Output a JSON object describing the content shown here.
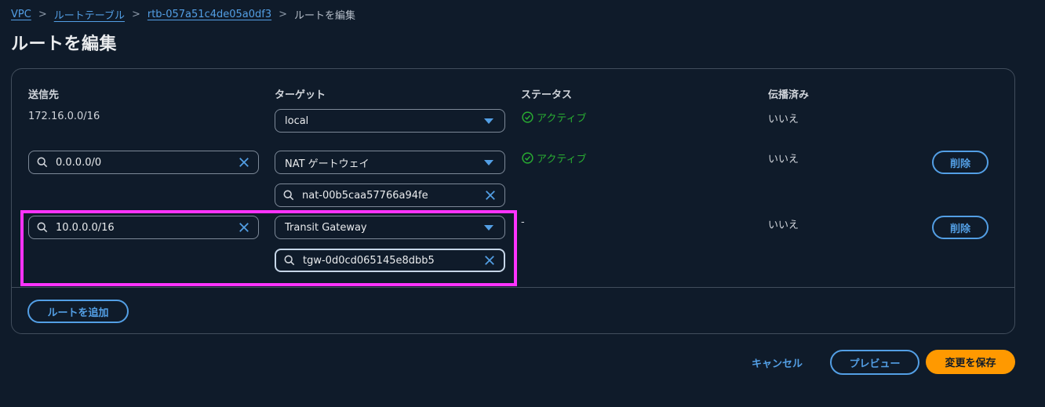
{
  "breadcrumb": {
    "items": [
      "VPC",
      "ルートテーブル",
      "rtb-057a51c4de05a0df3"
    ],
    "current": "ルートを編集"
  },
  "page_title": "ルートを編集",
  "columns": {
    "destination": "送信先",
    "target": "ターゲット",
    "status": "ステータス",
    "propagated": "伝播済み"
  },
  "routes": [
    {
      "destination": "172.16.0.0/16",
      "target_type": "local",
      "status": "アクティブ",
      "propagated": "いいえ"
    },
    {
      "destination": "0.0.0.0/0",
      "target_type": "NAT ゲートウェイ",
      "target_id": "nat-00b5caa57766a94fe",
      "status": "アクティブ",
      "propagated": "いいえ",
      "delete_label": "削除"
    },
    {
      "destination": "10.0.0.0/16",
      "target_type": "Transit Gateway",
      "target_id": "tgw-0d0cd065145e8dbb5",
      "status": "-",
      "propagated": "いいえ",
      "delete_label": "削除"
    }
  ],
  "add_route_label": "ルートを追加",
  "footer": {
    "cancel": "キャンセル",
    "preview": "プレビュー",
    "save": "変更を保存"
  },
  "colors": {
    "background": "#0f1b2a",
    "accent": "#539fe5",
    "success": "#29ad32",
    "primary": "#ff9900",
    "highlight": "#ff33ff"
  }
}
